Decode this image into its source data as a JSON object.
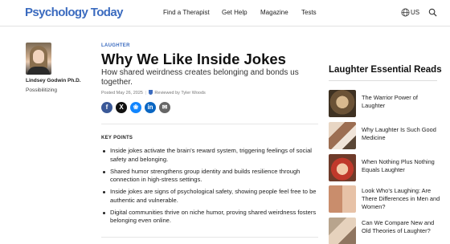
{
  "header": {
    "logo": "Psychology Today",
    "nav": [
      "Find a Therapist",
      "Get Help",
      "Magazine",
      "Tests"
    ],
    "region": "US"
  },
  "author": {
    "name": "Lindsey Godwin Ph.D.",
    "blog": "Possibilitizing"
  },
  "article": {
    "section": "LAUGHTER",
    "title": "Why We Like Inside Jokes",
    "subtitle": "How shared weirdness creates belonging and bonds us together.",
    "posted": "Posted May 26, 2025",
    "reviewed": "Reviewed by Tyler Woods",
    "share": {
      "facebook": "f",
      "x": "X",
      "bluesky": "❀",
      "linkedin": "in",
      "email": "✉"
    },
    "key_points_label": "KEY POINTS",
    "key_points": [
      "Inside jokes activate the brain’s reward system, triggering feelings of social safety and belonging.",
      "Shared humor strengthens group identity and builds resilience through connection in high-stress settings.",
      "Inside jokes are signs of psychological safety, showing people feel free to be authentic and vulnerable.",
      "Digital communities thrive on niche humor, proving shared weirdness fosters belonging even online."
    ]
  },
  "sidebar": {
    "title": "Laughter Essential Reads",
    "items": [
      {
        "label": "The Warrior Power of Laughter"
      },
      {
        "label": "Why Laughter Is Such Good Medicine"
      },
      {
        "label": "When Nothing Plus Nothing Equals Laughter"
      },
      {
        "label": "Look Who’s Laughing: Are There Differences in Men and Women?"
      },
      {
        "label": "Can We Compare New and Old Theories of Laughter?"
      }
    ]
  },
  "colors": {
    "brand": "#3b6bbf",
    "facebook": "#3b5998",
    "bluesky": "#1185fe",
    "linkedin": "#0a66c2"
  }
}
